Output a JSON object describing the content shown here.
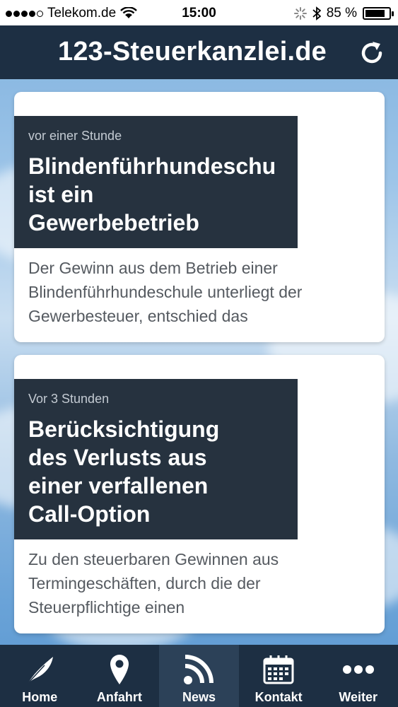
{
  "status_bar": {
    "carrier": "Telekom.de",
    "time": "15:00",
    "battery_percent": "85 %",
    "battery_level": 0.85
  },
  "header": {
    "title": "123-Steuerkanzlei.de",
    "refresh_icon": "refresh-icon"
  },
  "news": [
    {
      "time": "vor einer Stunde",
      "title": "Blindenführhundeschu\nist ein\nGewerbebetrieb",
      "teaser": "Der Gewinn aus dem Betrieb einer Blindenführhundeschule unterliegt der Gewerbesteuer, entschied das"
    },
    {
      "time": "Vor 3 Stunden",
      "title": "Berücksichtigung\ndes Verlusts aus\neiner verfallenen\nCall-Option",
      "teaser": "Zu den steuerbaren Gewinnen aus Termingeschäften, durch die der Steuerpflichtige einen"
    }
  ],
  "tabs": [
    {
      "label": "Home",
      "icon": "feather-icon"
    },
    {
      "label": "Anfahrt",
      "icon": "map-pin-icon"
    },
    {
      "label": "News",
      "icon": "rss-icon",
      "active": true
    },
    {
      "label": "Kontakt",
      "icon": "calendar-icon"
    },
    {
      "label": "Weiter",
      "icon": "more-icon"
    }
  ],
  "colors": {
    "header_bg": "#1d2f43",
    "headline_box_bg": "#26323f",
    "active_tab_bg": "#2c4158"
  }
}
